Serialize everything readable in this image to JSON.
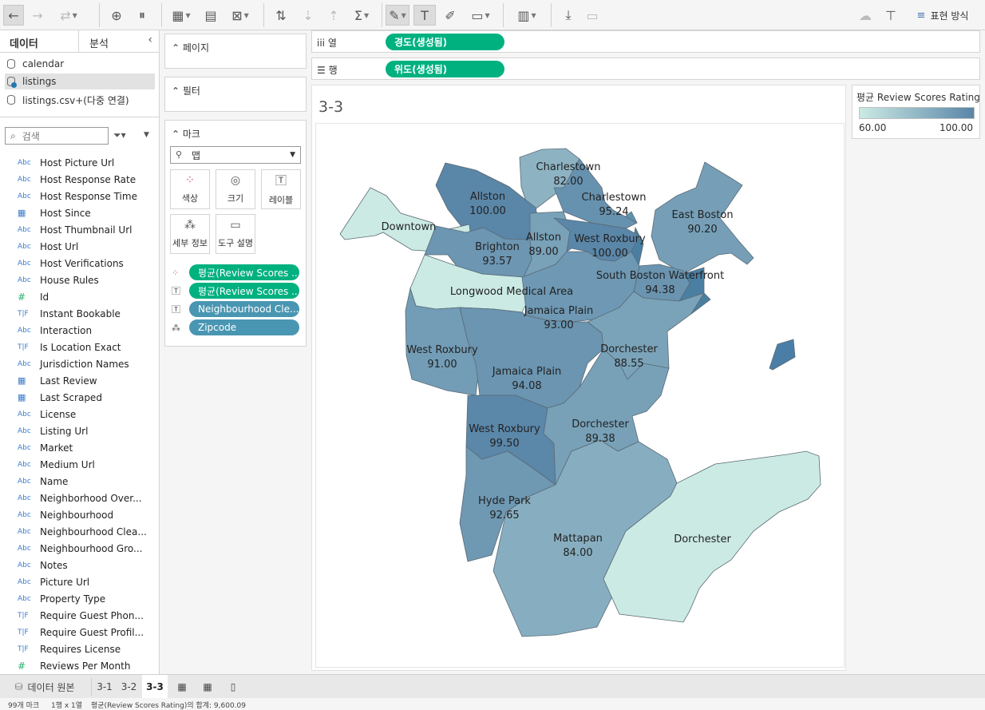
{
  "toolbar": {
    "show_me": "표현 방식"
  },
  "data_pane": {
    "tab_data": "데이터",
    "tab_analysis": "분석",
    "sources": [
      "calendar",
      "listings",
      "listings.csv+(다중 연결)"
    ],
    "search_placeholder": "검색",
    "fields": [
      {
        "type": "Abc",
        "name": "Host Picture Url"
      },
      {
        "type": "Abc",
        "name": "Host Response Rate"
      },
      {
        "type": "Abc",
        "name": "Host Response Time"
      },
      {
        "type": "date",
        "name": "Host Since"
      },
      {
        "type": "Abc",
        "name": "Host Thumbnail Url"
      },
      {
        "type": "Abc",
        "name": "Host Url"
      },
      {
        "type": "Abc",
        "name": "Host Verifications"
      },
      {
        "type": "Abc",
        "name": "House Rules"
      },
      {
        "type": "#",
        "name": "Id"
      },
      {
        "type": "T|F",
        "name": "Instant Bookable"
      },
      {
        "type": "Abc",
        "name": "Interaction"
      },
      {
        "type": "T|F",
        "name": "Is Location Exact"
      },
      {
        "type": "Abc",
        "name": "Jurisdiction Names"
      },
      {
        "type": "date",
        "name": "Last Review"
      },
      {
        "type": "date",
        "name": "Last Scraped"
      },
      {
        "type": "Abc",
        "name": "License"
      },
      {
        "type": "Abc",
        "name": "Listing Url"
      },
      {
        "type": "Abc",
        "name": "Market"
      },
      {
        "type": "Abc",
        "name": "Medium Url"
      },
      {
        "type": "Abc",
        "name": "Name"
      },
      {
        "type": "Abc",
        "name": "Neighborhood Over..."
      },
      {
        "type": "Abc",
        "name": "Neighbourhood"
      },
      {
        "type": "Abc",
        "name": "Neighbourhood Clea..."
      },
      {
        "type": "Abc",
        "name": "Neighbourhood Gro..."
      },
      {
        "type": "Abc",
        "name": "Notes"
      },
      {
        "type": "Abc",
        "name": "Picture Url"
      },
      {
        "type": "Abc",
        "name": "Property Type"
      },
      {
        "type": "T|F",
        "name": "Require Guest Phon..."
      },
      {
        "type": "T|F",
        "name": "Require Guest Profil..."
      },
      {
        "type": "T|F",
        "name": "Requires License"
      },
      {
        "type": "#",
        "name": "Reviews Per Month"
      }
    ]
  },
  "shelves": {
    "pages": "페이지",
    "filters": "필터",
    "marks": "마크",
    "mark_type": "맵",
    "mark_buttons": [
      "색상",
      "크기",
      "레이블",
      "세부 정보",
      "도구 설명"
    ],
    "mark_pills": [
      {
        "kind": "color",
        "label": "평균(Review Scores ..."
      },
      {
        "kind": "label",
        "label": "평균(Review Scores ..."
      },
      {
        "kind": "label",
        "label": "Neighbourhood Cle..."
      },
      {
        "kind": "detail",
        "label": "Zipcode"
      }
    ],
    "columns_label": "열",
    "columns_pill": "경도(생성됨)",
    "rows_label": "행",
    "rows_pill": "위도(생성됨)"
  },
  "sheet_title": "3-3",
  "legend": {
    "title": "평균 Review Scores Rating",
    "min": "60.00",
    "max": "100.00",
    "color_low": "#cbeae4",
    "color_high": "#5a86a8"
  },
  "chart_data": {
    "type": "map",
    "measure": "평균(Review Scores Rating)",
    "regions": [
      {
        "name": "Charlestown",
        "value": 82.0,
        "value_label": "82.00"
      },
      {
        "name": "Allston",
        "value": 100.0,
        "value_label": "100.00"
      },
      {
        "name": "Charlestown",
        "value": 95.24,
        "value_label": "95.24"
      },
      {
        "name": "East Boston",
        "value": 90.2,
        "value_label": "90.20"
      },
      {
        "name": "Downtown",
        "value": null,
        "value_label": ""
      },
      {
        "name": "Brighton",
        "value": 93.57,
        "value_label": "93.57"
      },
      {
        "name": "Allston",
        "value": 89.0,
        "value_label": "89.00"
      },
      {
        "name": "West Roxbury",
        "value": 100.0,
        "value_label": "100.00"
      },
      {
        "name": "South Boston Waterfront",
        "value": 94.38,
        "value_label": "94.38"
      },
      {
        "name": "Longwood Medical Area",
        "value": null,
        "value_label": ""
      },
      {
        "name": "Jamaica Plain",
        "value": 93.0,
        "value_label": "93.00"
      },
      {
        "name": "West Roxbury",
        "value": 91.0,
        "value_label": "91.00"
      },
      {
        "name": "Dorchester",
        "value": 88.55,
        "value_label": "88.55"
      },
      {
        "name": "Jamaica Plain",
        "value": 94.08,
        "value_label": "94.08"
      },
      {
        "name": "West Roxbury",
        "value": 99.5,
        "value_label": "99.50"
      },
      {
        "name": "Dorchester",
        "value": 89.38,
        "value_label": "89.38"
      },
      {
        "name": "Hyde Park",
        "value": 92.65,
        "value_label": "92.65"
      },
      {
        "name": "Mattapan",
        "value": 84.0,
        "value_label": "84.00"
      },
      {
        "name": "Dorchester",
        "value": null,
        "value_label": ""
      }
    ]
  },
  "tabs": {
    "data_source": "데이터 원본",
    "sheets": [
      "3-1",
      "3-2",
      "3-3"
    ]
  },
  "status": {
    "marks": "99개 마크",
    "rows_cols": "1행 x 1열",
    "sum": "평균(Review Scores Rating)의 합계: 9,600.09"
  }
}
